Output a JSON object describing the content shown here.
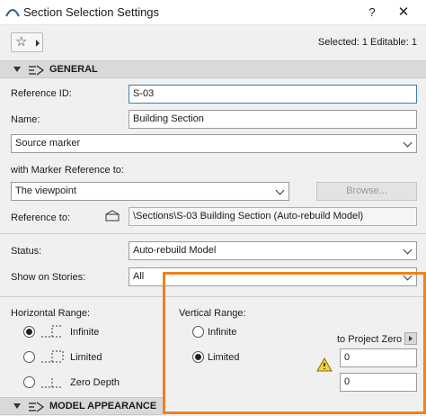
{
  "window": {
    "title": "Section Selection Settings",
    "help": "?",
    "close": "✕"
  },
  "toolbar": {
    "favorite_icon": "☆",
    "selected_info": "Selected: 1 Editable: 1"
  },
  "general": {
    "header": "GENERAL",
    "reference_id": {
      "label": "Reference ID:",
      "value": "S-03"
    },
    "name": {
      "label": "Name:",
      "value": "Building Section"
    },
    "marker_type": {
      "value": "Source marker"
    },
    "marker_reference": {
      "label": "with Marker Reference to:",
      "value": "The viewpoint",
      "browse": "Browse..."
    },
    "reference_to": {
      "label": "Reference to:",
      "value": "\\Sections\\S-03 Building Section (Auto-rebuild Model)"
    },
    "status": {
      "label": "Status:",
      "value": "Auto-rebuild Model"
    },
    "show_on_stories": {
      "label": "Show on Stories:",
      "value": "All"
    },
    "horizontal_range": {
      "label": "Horizontal Range:",
      "options": [
        {
          "label": "Infinite",
          "selected": true
        },
        {
          "label": "Limited",
          "selected": false
        },
        {
          "label": "Zero Depth",
          "selected": false
        }
      ]
    },
    "vertical_range": {
      "label": "Vertical Range:",
      "options": [
        {
          "label": "Infinite",
          "selected": false
        },
        {
          "label": "Limited",
          "selected": true
        }
      ],
      "to_project_zero": "to Project Zero",
      "top_value": "0",
      "bottom_value": "0"
    }
  },
  "model_appearance": {
    "header": "MODEL APPEARANCE"
  },
  "colors": {
    "accent_highlight": "#f0821e",
    "focus_border": "#3c7fb1"
  }
}
